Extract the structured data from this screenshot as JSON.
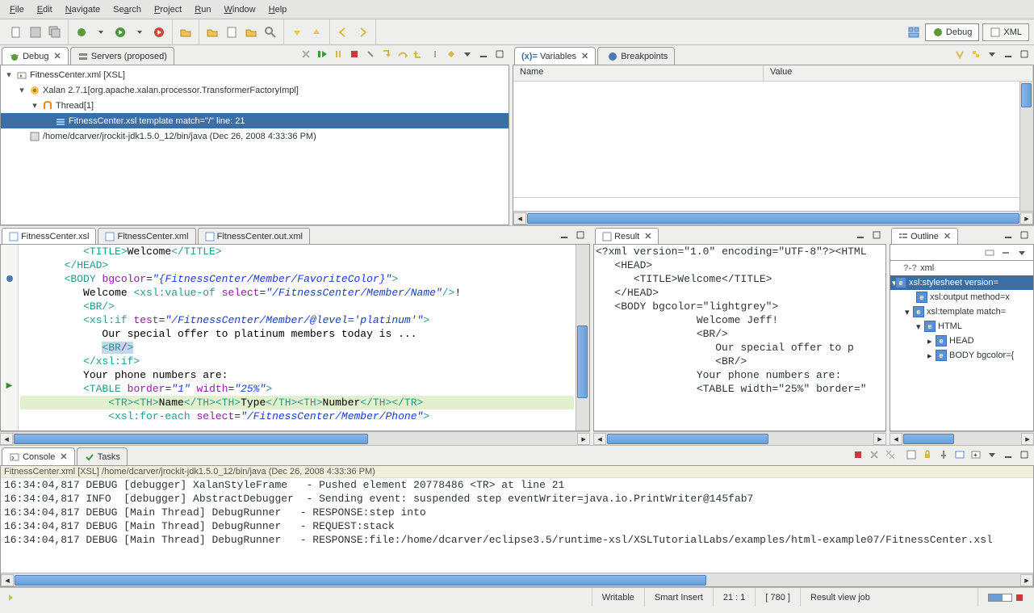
{
  "menubar": {
    "items": [
      {
        "label": "File",
        "mn": 0
      },
      {
        "label": "Edit",
        "mn": 0
      },
      {
        "label": "Navigate",
        "mn": 0
      },
      {
        "label": "Search",
        "mn": 2
      },
      {
        "label": "Project",
        "mn": 0
      },
      {
        "label": "Run",
        "mn": 0
      },
      {
        "label": "Window",
        "mn": 0
      },
      {
        "label": "Help",
        "mn": 0
      }
    ]
  },
  "perspectives": {
    "debug": "Debug",
    "xml": "XML"
  },
  "debug_view": {
    "title": "Debug",
    "servers_tab": "Servers (proposed)",
    "tree": {
      "root": "FitnessCenter.xml [XSL]",
      "process": "Xalan 2.7.1[org.apache.xalan.processor.TransformerFactoryImpl]",
      "thread": "Thread[1]",
      "frame": "FitnessCenter.xsl template match=\"/\" line: 21",
      "terminated": "/home/dcarver/jrockit-jdk1.5.0_12/bin/java (Dec 26, 2008 4:33:36 PM)"
    }
  },
  "variables_view": {
    "title": "Variables",
    "breakpoints_tab": "Breakpoints",
    "col_name": "Name",
    "col_value": "Value"
  },
  "editor_tabs": {
    "t0": "FitnessCenter.xsl",
    "t1": "FitnessCenter.xml",
    "t2": "FitnessCenter.out.xml"
  },
  "result_view": {
    "title": "Result"
  },
  "outline_view": {
    "title": "Outline",
    "items": {
      "xml_decl": "xml",
      "stylesheet": "xsl:stylesheet version=",
      "output": "xsl:output method=x",
      "template": "xsl:template match=",
      "html": "HTML",
      "head": "HEAD",
      "body": "BODY bgcolor={"
    }
  },
  "console_view": {
    "title": "Console",
    "tasks_tab": "Tasks",
    "process_label": "FitnessCenter.xml [XSL] /home/dcarver/jrockit-jdk1.5.0_12/bin/java (Dec 26, 2008 4:33:36 PM)",
    "lines": [
      "16:34:04,817 DEBUG [debugger] XalanStyleFrame   - Pushed element 20778486 <TR> at line 21",
      "16:34:04,817 INFO  [debugger] AbstractDebugger  - Sending event: suspended step eventWriter=java.io.PrintWriter@145fab7",
      "16:34:04,817 DEBUG [Main Thread] DebugRunner   - RESPONSE:step into",
      "16:34:04,817 DEBUG [Main Thread] DebugRunner   - REQUEST:stack",
      "16:34:04,817 DEBUG [Main Thread] DebugRunner   - RESPONSE:file:/home/dcarver/eclipse3.5/runtime-xsl/XSLTutorialLabs/examples/html-example07/FitnessCenter.xsl"
    ]
  },
  "statusbar": {
    "writable": "Writable",
    "insert": "Smart Insert",
    "cursor": "21 : 1",
    "sel": "[ 780 ]",
    "job": "Result view job"
  }
}
